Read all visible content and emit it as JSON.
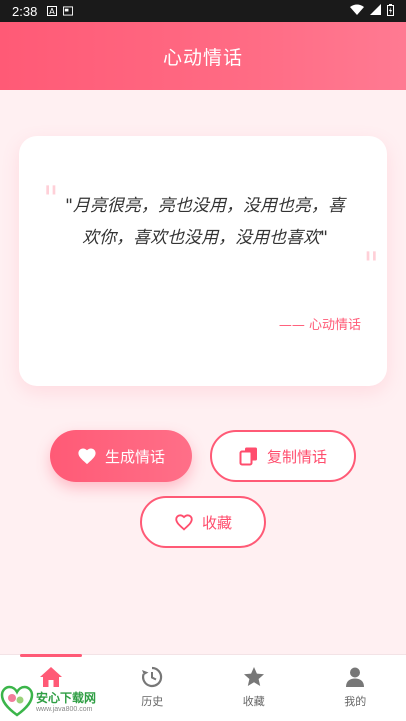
{
  "status_bar": {
    "time": "2:38"
  },
  "header": {
    "title": "心动情话"
  },
  "quote": {
    "text": "\"月亮很亮，亮也没用，没用也亮，喜欢你，喜欢也没用，没用也喜欢\"",
    "source": "—— 心动情话"
  },
  "actions": {
    "generate_label": "生成情话",
    "copy_label": "复制情话",
    "favorite_label": "收藏"
  },
  "nav": {
    "items": [
      {
        "label": "",
        "icon": "home-icon"
      },
      {
        "label": "历史",
        "icon": "history-icon"
      },
      {
        "label": "收藏",
        "icon": "star-icon"
      },
      {
        "label": "我的",
        "icon": "person-icon"
      }
    ],
    "active_index": 0
  },
  "watermark": {
    "title": "安心下载网",
    "subtitle": "www.java800.com"
  },
  "colors": {
    "accent": "#ff5a76",
    "background": "#fff0f2",
    "card": "#ffffff"
  }
}
